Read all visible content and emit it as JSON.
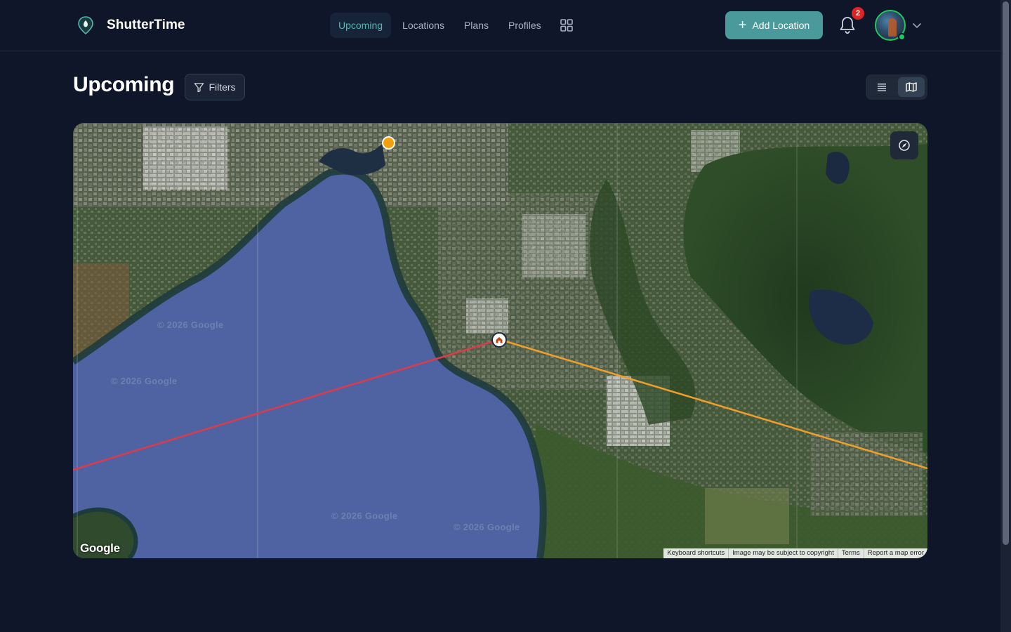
{
  "app": {
    "name": "ShutterTime"
  },
  "nav": {
    "items": [
      {
        "label": "Upcoming",
        "active": true
      },
      {
        "label": "Locations",
        "active": false
      },
      {
        "label": "Plans",
        "active": false
      },
      {
        "label": "Profiles",
        "active": false
      }
    ],
    "grid_icon": "grid-icon"
  },
  "header": {
    "add_location_label": "Add Location",
    "notification_count": "2",
    "accent_color": "#4a9a9b"
  },
  "page": {
    "title": "Upcoming",
    "filters_label": "Filters",
    "view_mode": "map"
  },
  "map": {
    "provider_logo": "Google",
    "watermarks": [
      "© 2026 Google",
      "© 2026 Google",
      "© 2026 Google",
      "© 2026 Google"
    ],
    "attribution": [
      "Keyboard shortcuts",
      "Image may be subject to copyright",
      "Terms",
      "Report a map error"
    ],
    "sunrise_line_color": "#f59e0b",
    "sunset_line_color": "#dc3b4b",
    "water_color": "#4f63a3"
  }
}
